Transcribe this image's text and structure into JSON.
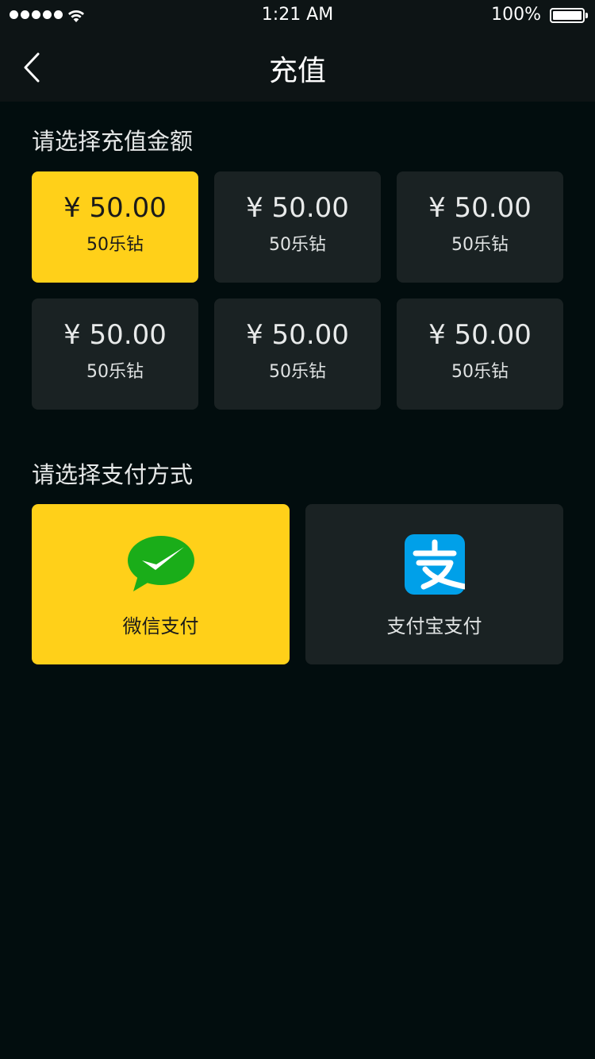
{
  "status_bar": {
    "time": "1:21 AM",
    "battery": "100%"
  },
  "nav": {
    "title": "充值",
    "back_icon": "chevron-left-icon"
  },
  "amount_section": {
    "title": "请选择充值金额",
    "selected_index": 0,
    "options": [
      {
        "price": "¥ 50.00",
        "diamonds": "50乐钻"
      },
      {
        "price": "¥ 50.00",
        "diamonds": "50乐钻"
      },
      {
        "price": "¥ 50.00",
        "diamonds": "50乐钻"
      },
      {
        "price": "¥ 50.00",
        "diamonds": "50乐钻"
      },
      {
        "price": "¥ 50.00",
        "diamonds": "50乐钻"
      },
      {
        "price": "¥ 50.00",
        "diamonds": "50乐钻"
      }
    ]
  },
  "payment_section": {
    "title": "请选择支付方式",
    "selected_index": 0,
    "methods": [
      {
        "label": "微信支付",
        "icon": "wechat-pay-icon"
      },
      {
        "label": "支付宝支付",
        "icon": "alipay-icon"
      }
    ]
  },
  "colors": {
    "accent": "#ffd019",
    "card": "#1a2223",
    "background": "#020d0e",
    "wechat_green": "#1aad19",
    "alipay_blue": "#00a0e9"
  }
}
